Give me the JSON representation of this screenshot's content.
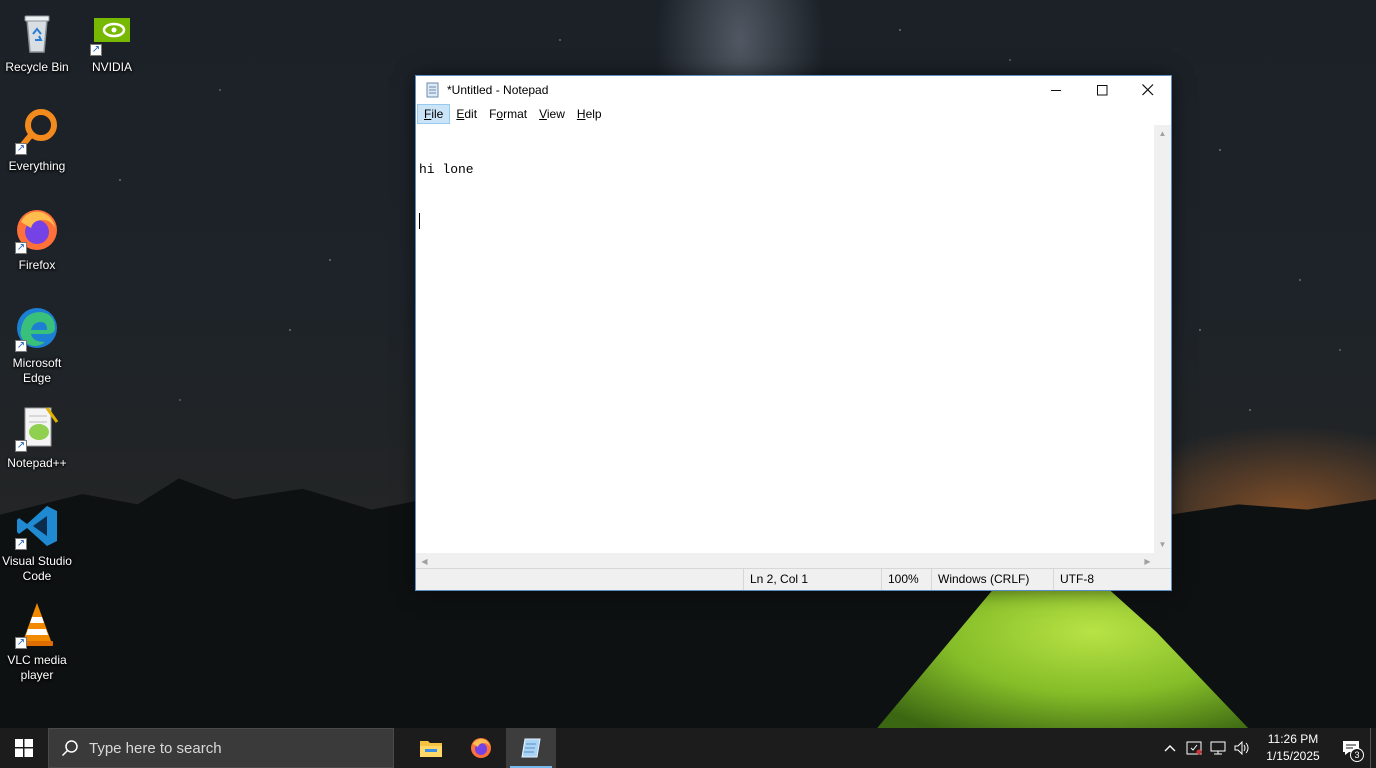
{
  "desktop": {
    "icons": [
      {
        "label": "Recycle Bin",
        "icon": "recycle-bin-icon"
      },
      {
        "label": "NVIDIA",
        "icon": "nvidia-icon"
      },
      {
        "label": "Everything",
        "icon": "everything-search-icon"
      },
      {
        "label": "Firefox",
        "icon": "firefox-icon"
      },
      {
        "label": "Microsoft Edge",
        "icon": "edge-icon"
      },
      {
        "label": "Notepad++",
        "icon": "notepad-plus-plus-icon"
      },
      {
        "label": "Visual Studio Code",
        "icon": "vscode-icon"
      },
      {
        "label": "VLC media player",
        "icon": "vlc-icon"
      }
    ]
  },
  "notepad": {
    "title": "*Untitled - Notepad",
    "menu": [
      {
        "label": "File",
        "mnemonic": "F",
        "rest": "ile"
      },
      {
        "label": "Edit",
        "mnemonic": "E",
        "rest": "dit"
      },
      {
        "label": "Format",
        "mnemonic": "o",
        "pre": "F",
        "rest": "rmat"
      },
      {
        "label": "View",
        "mnemonic": "V",
        "rest": "iew"
      },
      {
        "label": "Help",
        "mnemonic": "H",
        "rest": "elp"
      }
    ],
    "content": "hi lone",
    "status": {
      "position": "Ln 2, Col 1",
      "zoom": "100%",
      "line_ending": "Windows (CRLF)",
      "encoding": "UTF-8"
    }
  },
  "taskbar": {
    "search_placeholder": "Type here to search",
    "apps": [
      "file-explorer-icon",
      "firefox-icon",
      "notepad-icon"
    ],
    "active_app": "notepad-icon",
    "time": "11:26 PM",
    "date": "1/15/2025",
    "notification_count": "3"
  },
  "colors": {
    "taskbar": "#1c1c1c",
    "menu_highlight": "#cce4f7",
    "active_indicator": "#76b9ed"
  }
}
